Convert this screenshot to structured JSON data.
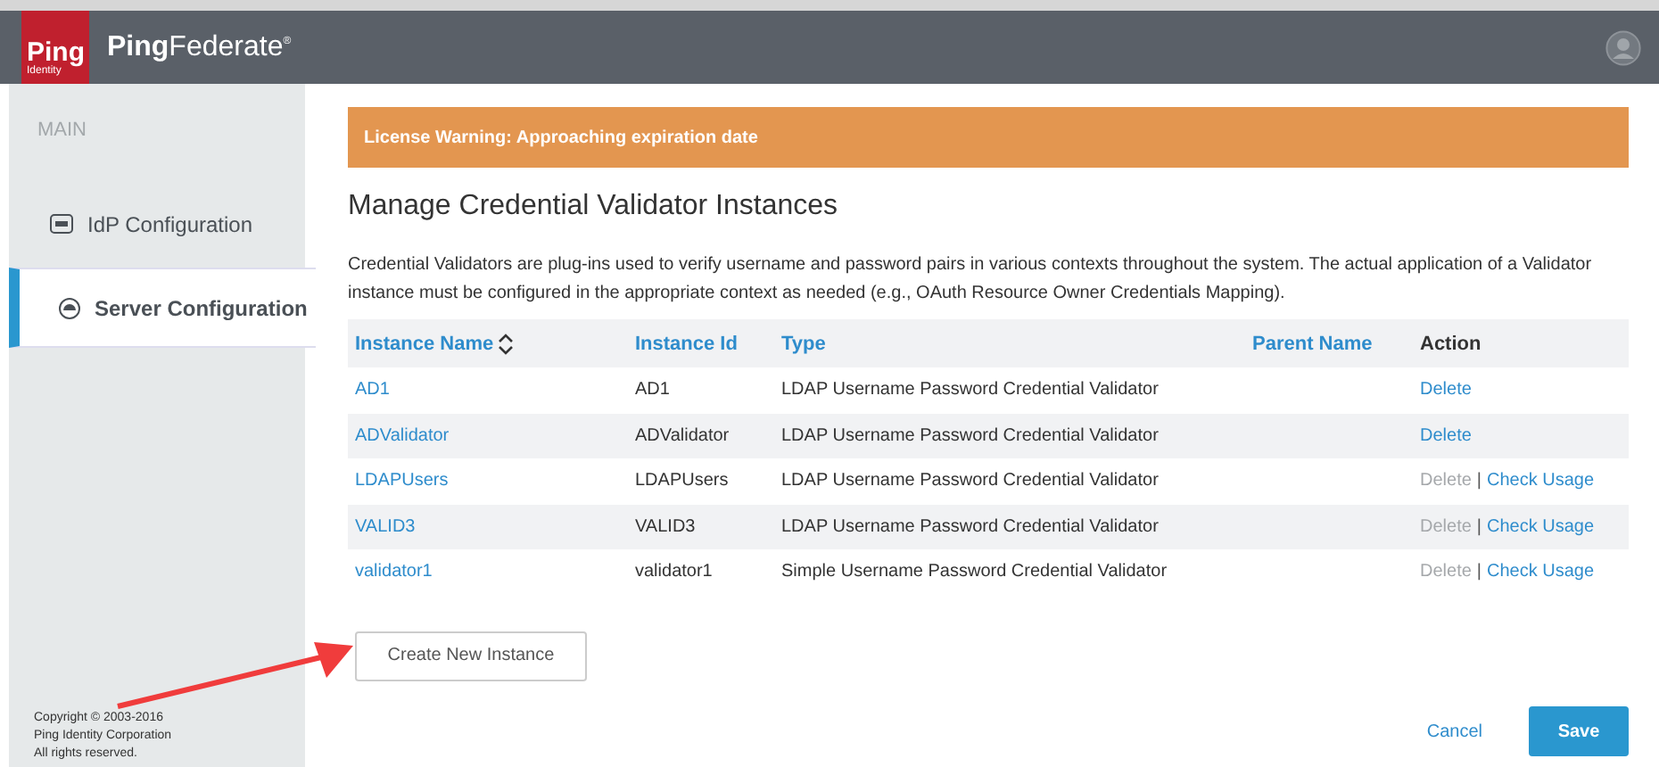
{
  "header": {
    "logo_mark": "Ping",
    "logo_sub": "Identity",
    "product_bold": "Ping",
    "product_light": "Federate",
    "product_mark": "®"
  },
  "sidebar": {
    "section": "MAIN",
    "items": [
      {
        "label": "IdP Configuration",
        "kind": "idp",
        "selected": false
      },
      {
        "label": "Server Configuration",
        "kind": "server",
        "selected": true
      }
    ],
    "copyright": [
      "Copyright © 2003-2016",
      "Ping Identity Corporation",
      "All rights reserved."
    ]
  },
  "warning": "License Warning: Approaching expiration date",
  "title": "Manage Credential Validator Instances",
  "description": "Credential Validators are plug-ins used to verify username and password pairs in various contexts throughout the system. The actual application of a Validator instance must be configured in the appropriate context as needed (e.g., OAuth Resource Owner Credentials Mapping).",
  "table": {
    "columns": [
      {
        "label": "Instance Name",
        "sortable": true,
        "link": true
      },
      {
        "label": "Instance Id",
        "sortable": false,
        "link": true
      },
      {
        "label": "Type",
        "sortable": false,
        "link": true
      },
      {
        "label": "Parent Name",
        "sortable": false,
        "link": true
      },
      {
        "label": "Action",
        "sortable": false,
        "link": false
      }
    ],
    "action_separator": "|",
    "rows": [
      {
        "name": "AD1",
        "id": "AD1",
        "type": "LDAP Username Password Credential Validator",
        "actions": [
          {
            "label": "Delete",
            "disabled": false
          }
        ]
      },
      {
        "name": "ADValidator",
        "id": "ADValidator",
        "type": "LDAP Username Password Credential Validator",
        "actions": [
          {
            "label": "Delete",
            "disabled": false
          }
        ]
      },
      {
        "name": "LDAPUsers",
        "id": "LDAPUsers",
        "type": "LDAP Username Password Credential Validator",
        "actions": [
          {
            "label": "Delete",
            "disabled": true
          },
          {
            "label": "Check Usage",
            "disabled": false
          }
        ]
      },
      {
        "name": "VALID3",
        "id": "VALID3",
        "type": "LDAP Username Password Credential Validator",
        "actions": [
          {
            "label": "Delete",
            "disabled": true
          },
          {
            "label": "Check Usage",
            "disabled": false
          }
        ]
      },
      {
        "name": "validator1",
        "id": "validator1",
        "type": "Simple Username Password Credential Validator",
        "actions": [
          {
            "label": "Delete",
            "disabled": true
          },
          {
            "label": "Check Usage",
            "disabled": false
          }
        ]
      }
    ]
  },
  "create_button": "Create New Instance",
  "cancel": "Cancel",
  "save": "Save"
}
